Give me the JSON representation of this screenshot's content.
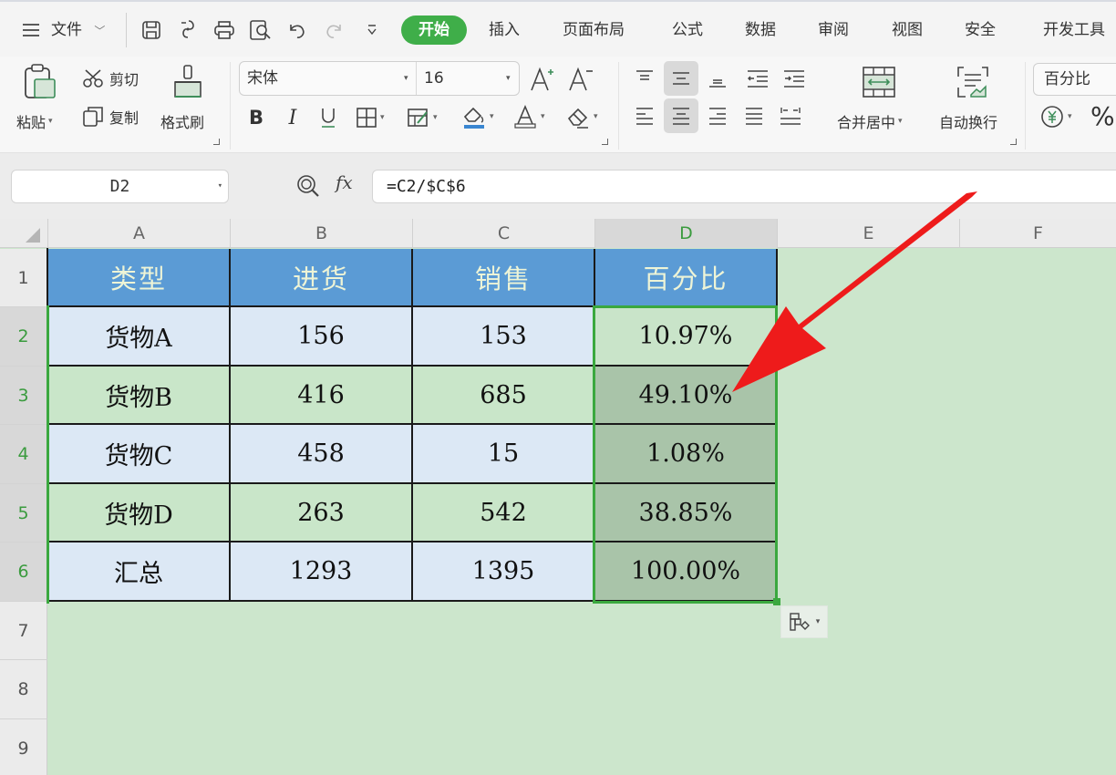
{
  "menubar": {
    "file_label": "文件",
    "tabs": [
      {
        "label": "开始",
        "active": true
      },
      {
        "label": "插入"
      },
      {
        "label": "页面布局"
      },
      {
        "label": "公式"
      },
      {
        "label": "数据"
      },
      {
        "label": "审阅"
      },
      {
        "label": "视图"
      },
      {
        "label": "安全"
      },
      {
        "label": "开发工具"
      }
    ],
    "quick_icons": [
      "menu-icon",
      "save-icon",
      "export-icon",
      "print-icon",
      "print-preview-icon",
      "undo-icon",
      "redo-icon",
      "customize-dropdown-icon"
    ]
  },
  "ribbon": {
    "paste_label": "粘贴",
    "cut_label": "剪切",
    "copy_label": "复制",
    "format_painter_label": "格式刷",
    "font_name": "宋体",
    "font_size": "16",
    "merge_center_label": "合并居中",
    "wrap_text_label": "自动换行",
    "number_format": "百分比",
    "percent_symbol": "%",
    "accent_color": "#3fae49"
  },
  "formula_bar": {
    "name_box": "D2",
    "fx_label": "fx",
    "formula": "=C2/$C$6"
  },
  "sheet": {
    "columns": [
      "A",
      "B",
      "C",
      "D",
      "E",
      "F"
    ],
    "selected_column": "D",
    "rows": [
      "1",
      "2",
      "3",
      "4",
      "5",
      "6",
      "7",
      "8",
      "9"
    ],
    "selected_rows": [
      "2",
      "3",
      "4",
      "5",
      "6"
    ],
    "header_fill": "#5b9bd5",
    "table": {
      "headers": [
        "类型",
        "进货",
        "销售",
        "百分比"
      ],
      "rows": [
        [
          "货物A",
          "156",
          "153",
          "10.97%"
        ],
        [
          "货物B",
          "416",
          "685",
          "49.10%"
        ],
        [
          "货物C",
          "458",
          "15",
          "1.08%"
        ],
        [
          "货物D",
          "263",
          "542",
          "38.85%"
        ],
        [
          "汇总",
          "1293",
          "1395",
          "100.00%"
        ]
      ]
    },
    "selection_range": "D2:D6",
    "selection_color": "#3aa83e"
  },
  "annotation": {
    "arrow_color": "#ee1b1b",
    "points_to": "D3"
  }
}
